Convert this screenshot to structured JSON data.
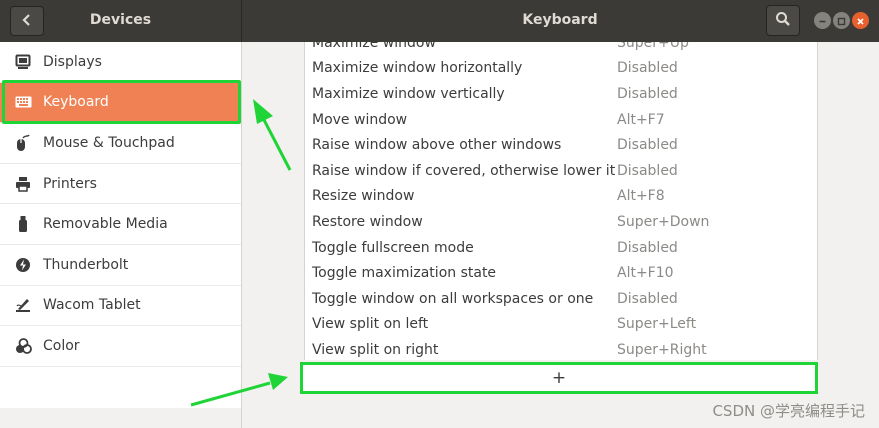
{
  "header": {
    "left_title": "Devices",
    "right_title": "Keyboard"
  },
  "sidebar": {
    "items": [
      {
        "label": "Displays",
        "icon": "display-icon",
        "selected": false
      },
      {
        "label": "Keyboard",
        "icon": "keyboard-icon",
        "selected": true
      },
      {
        "label": "Mouse & Touchpad",
        "icon": "mouse-icon",
        "selected": false
      },
      {
        "label": "Printers",
        "icon": "printer-icon",
        "selected": false
      },
      {
        "label": "Removable Media",
        "icon": "usb-drive-icon",
        "selected": false
      },
      {
        "label": "Thunderbolt",
        "icon": "thunderbolt-icon",
        "selected": false
      },
      {
        "label": "Wacom Tablet",
        "icon": "tablet-pen-icon",
        "selected": false
      },
      {
        "label": "Color",
        "icon": "color-icon",
        "selected": false
      }
    ]
  },
  "shortcuts": [
    {
      "name": "Maximize window",
      "accel": "Super+Up"
    },
    {
      "name": "Maximize window horizontally",
      "accel": "Disabled"
    },
    {
      "name": "Maximize window vertically",
      "accel": "Disabled"
    },
    {
      "name": "Move window",
      "accel": "Alt+F7"
    },
    {
      "name": "Raise window above other windows",
      "accel": "Disabled"
    },
    {
      "name": "Raise window if covered, otherwise lower it",
      "accel": "Disabled"
    },
    {
      "name": "Resize window",
      "accel": "Alt+F8"
    },
    {
      "name": "Restore window",
      "accel": "Super+Down"
    },
    {
      "name": "Toggle fullscreen mode",
      "accel": "Disabled"
    },
    {
      "name": "Toggle maximization state",
      "accel": "Alt+F10"
    },
    {
      "name": "Toggle window on all workspaces or one",
      "accel": "Disabled"
    },
    {
      "name": "View split on left",
      "accel": "Super+Left"
    },
    {
      "name": "View split on right",
      "accel": "Super+Right"
    }
  ],
  "add_button_label": "+",
  "watermark": "CSDN @学亮编程手记",
  "colors": {
    "accent": "#f08154",
    "highlight": "#1fd437",
    "headerbar": "#3b3a37",
    "close": "#e8602d"
  }
}
